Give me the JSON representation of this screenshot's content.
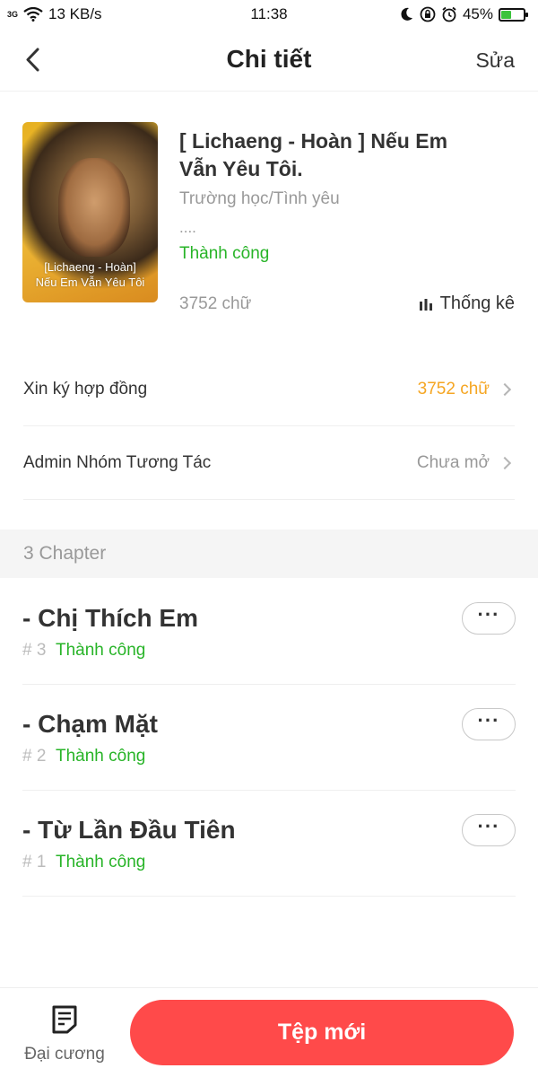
{
  "status_bar": {
    "network": "3G",
    "speed": "13 KB/s",
    "time": "11:38",
    "battery": "45%",
    "battery_level": 0.45
  },
  "nav": {
    "title": "Chi tiết",
    "edit_label": "Sửa"
  },
  "book": {
    "cover_text_line1": "[Lichaeng - Hoàn]",
    "cover_text_line2": "Nếu Em Vẫn Yêu Tôi",
    "title": "[ Lichaeng - Hoàn ] Nếu Em Vẫn Yêu Tôi.",
    "genre": "Trường học/Tình yêu",
    "description": "....",
    "status": "Thành công",
    "word_count": "3752 chữ",
    "stats_label": "Thống kê"
  },
  "rows": [
    {
      "label": "Xin ký hợp đồng",
      "value": "3752 chữ",
      "value_color": "#f5a623"
    },
    {
      "label": "Admin Nhóm Tương Tác",
      "value": "Chưa mở",
      "value_color": "#999999"
    }
  ],
  "chapters_header": "3 Chapter",
  "chapters": [
    {
      "title": "- Chị Thích Em",
      "number": "# 3",
      "status": "Thành công",
      "more": "···"
    },
    {
      "title": "- Chạm Mặt",
      "number": "# 2",
      "status": "Thành công",
      "more": "···"
    },
    {
      "title": "- Từ Lần Đầu Tiên",
      "number": "# 1",
      "status": "Thành công",
      "more": "···"
    }
  ],
  "bottom": {
    "outline_label": "Đại cương",
    "new_file_label": "Tệp mới"
  },
  "colors": {
    "accent_red": "#ff4a4a",
    "success_green": "#28b428",
    "warning_orange": "#f5a623"
  }
}
